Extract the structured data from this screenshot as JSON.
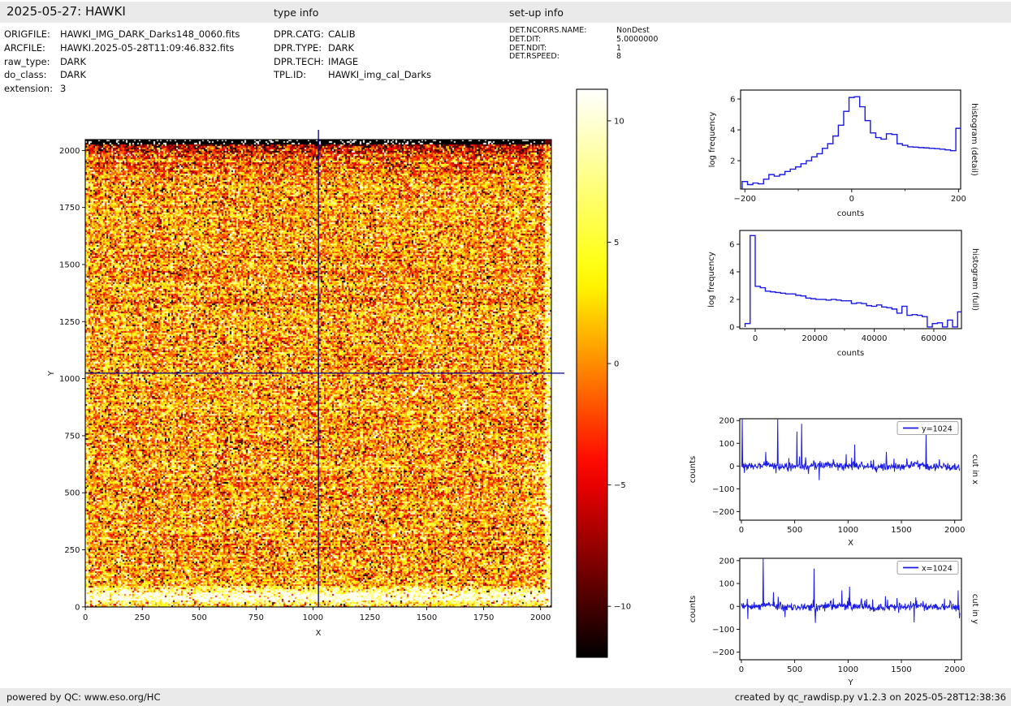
{
  "header": {
    "title": "2025-05-27: HAWKI",
    "type_info_title": "type info",
    "setup_info_title": "set-up info"
  },
  "file_info": {
    "rows": [
      {
        "label": "ORIGFILE:",
        "value": "HAWKI_IMG_DARK_Darks148_0060.fits"
      },
      {
        "label": "ARCFILE:",
        "value": "HAWKI.2025-05-28T11:09:46.832.fits"
      },
      {
        "label": "raw_type:",
        "value": "DARK"
      },
      {
        "label": "do_class:",
        "value": "DARK"
      },
      {
        "label": "extension:",
        "value": "3"
      }
    ]
  },
  "type_info": {
    "rows": [
      {
        "label": "DPR.CATG:",
        "value": "CALIB"
      },
      {
        "label": "DPR.TYPE:",
        "value": "DARK"
      },
      {
        "label": "DPR.TECH:",
        "value": "IMAGE"
      },
      {
        "label": "TPL.ID:",
        "value": "HAWKI_img_cal_Darks"
      }
    ]
  },
  "setup_info": {
    "rows": [
      {
        "label": "DET.NCORRS.NAME:",
        "value": "NonDest"
      },
      {
        "label": "DET.DIT:",
        "value": "5.0000000"
      },
      {
        "label": "DET.NDIT:",
        "value": "1"
      },
      {
        "label": "DET.RSPEED:",
        "value": "8"
      }
    ]
  },
  "footer": {
    "left": "powered by QC: www.eso.org/HC",
    "right": "created by qc_rawdisp.py v1.2.3 on 2025-05-28T12:38:36"
  },
  "colors": {
    "plot_line_blue": "#1a1ae6",
    "crosshair_navy": "#00008b",
    "bar_background": "#eaeaea",
    "frame_black": "#000000"
  },
  "chart_data": [
    {
      "id": "dark-frame-image",
      "type": "heatmap",
      "xlabel": "X",
      "ylabel": "Y",
      "xticks": [
        0,
        250,
        500,
        750,
        1000,
        1250,
        1500,
        1750,
        2000
      ],
      "yticks": [
        0,
        250,
        500,
        750,
        1000,
        1250,
        1500,
        1750,
        2000
      ],
      "xlim": [
        -0.5,
        2047.5
      ],
      "ylim": [
        -0.5,
        2047.5
      ],
      "colormap": "hot",
      "display_range": {
        "vmin": -12.1,
        "vmax": 11.3
      },
      "crosshair": {
        "x": 1024,
        "y": 1024
      },
      "features": {
        "dark_band_top_rows": true,
        "bright_glow_bottom_row": 45,
        "bright_right_edge": true,
        "white_streak": {
          "x": 1452,
          "y": 946,
          "angle_deg": 45
        }
      }
    },
    {
      "id": "colorbar",
      "type": "colorbar",
      "colormap": "hot",
      "ticks": [
        10,
        5,
        0,
        -5,
        -10
      ],
      "vmin": -12.1,
      "vmax": 11.3
    },
    {
      "id": "histogram-detail",
      "type": "bar",
      "subtype": "step_histogram",
      "right_label": "histogram (detail)",
      "xlabel": "counts",
      "ylabel": "log frequency",
      "xticks": [
        -200,
        0,
        200
      ],
      "minor_xticks": [
        -100,
        100
      ],
      "yticks": [
        2,
        4,
        6
      ],
      "xlim": [
        -208,
        204
      ],
      "ylim": [
        0.16,
        6.58
      ],
      "bin_start": -205,
      "bin_width": 10,
      "log_freq": [
        0.65,
        0.45,
        0.55,
        0.5,
        0.8,
        1.1,
        1.0,
        1.1,
        1.3,
        1.45,
        1.6,
        1.8,
        2.0,
        2.25,
        2.45,
        2.8,
        3.1,
        3.6,
        4.3,
        5.2,
        6.1,
        6.15,
        5.5,
        4.6,
        3.8,
        3.5,
        3.4,
        3.75,
        3.7,
        3.1,
        3.0,
        2.9,
        2.88,
        2.85,
        2.83,
        2.8,
        2.78,
        2.75,
        2.7,
        2.65,
        4.1
      ]
    },
    {
      "id": "histogram-full",
      "type": "bar",
      "subtype": "step_histogram",
      "right_label": "histogram (full)",
      "xlabel": "counts",
      "ylabel": "log frequency",
      "xticks": [
        0,
        20000,
        40000,
        60000
      ],
      "minor_xticks": [
        10000,
        30000,
        50000
      ],
      "yticks": [
        0,
        2,
        4,
        6
      ],
      "xlim": [
        -5185,
        69290
      ],
      "ylim": [
        -0.12,
        7.0
      ],
      "bin_start": -3400,
      "bin_width": 1700,
      "log_freq": [
        0.25,
        6.63,
        2.95,
        2.85,
        2.6,
        2.55,
        2.5,
        2.45,
        2.4,
        2.4,
        2.3,
        2.25,
        2.1,
        2.05,
        2.0,
        2.0,
        1.95,
        2.0,
        1.95,
        1.9,
        1.9,
        1.7,
        1.75,
        1.7,
        1.55,
        1.5,
        1.6,
        1.45,
        1.4,
        1.3,
        1.0,
        1.5,
        0.85,
        0.9,
        0.85,
        0.75,
        0.0,
        0.25,
        0.3,
        0.0,
        0.5,
        0.0,
        1.1
      ]
    },
    {
      "id": "cut-in-x",
      "type": "line",
      "legend": "y=1024",
      "right_label": "cut in x",
      "xlabel": "X",
      "ylabel": "counts",
      "xticks": [
        0,
        500,
        1000,
        1500,
        2000
      ],
      "yticks": [
        -200,
        -100,
        0,
        100,
        200
      ],
      "xlim": [
        -15,
        2063
      ],
      "ylim": [
        -238,
        208
      ],
      "noise_sigma": 9,
      "seed": 1337,
      "spikes": [
        [
          8,
          215
        ],
        [
          30,
          -30
        ],
        [
          230,
          62
        ],
        [
          340,
          212
        ],
        [
          445,
          35
        ],
        [
          520,
          152
        ],
        [
          545,
          42
        ],
        [
          565,
          186
        ],
        [
          600,
          38
        ],
        [
          730,
          -62
        ],
        [
          860,
          30
        ],
        [
          980,
          52
        ],
        [
          1062,
          95
        ],
        [
          1240,
          28
        ],
        [
          1360,
          62
        ],
        [
          1430,
          32
        ],
        [
          1650,
          25
        ],
        [
          1730,
          142
        ]
      ]
    },
    {
      "id": "cut-in-y",
      "type": "line",
      "legend": "x=1024",
      "right_label": "cut in y",
      "xlabel": "Y",
      "ylabel": "counts",
      "xticks": [
        0,
        500,
        1000,
        1500,
        2000
      ],
      "yticks": [
        -200,
        -100,
        0,
        100,
        200
      ],
      "xlim": [
        -15,
        2063
      ],
      "ylim": [
        -233,
        210
      ],
      "noise_sigma": 9,
      "seed": 2024,
      "spikes": [
        [
          60,
          -55
        ],
        [
          205,
          212
        ],
        [
          300,
          62
        ],
        [
          345,
          42
        ],
        [
          680,
          165
        ],
        [
          692,
          -72
        ],
        [
          860,
          35
        ],
        [
          940,
          70
        ],
        [
          1012,
          86
        ],
        [
          1175,
          32
        ],
        [
          1352,
          45
        ],
        [
          1620,
          -70
        ],
        [
          2030,
          70
        ],
        [
          2042,
          -52
        ]
      ]
    }
  ]
}
